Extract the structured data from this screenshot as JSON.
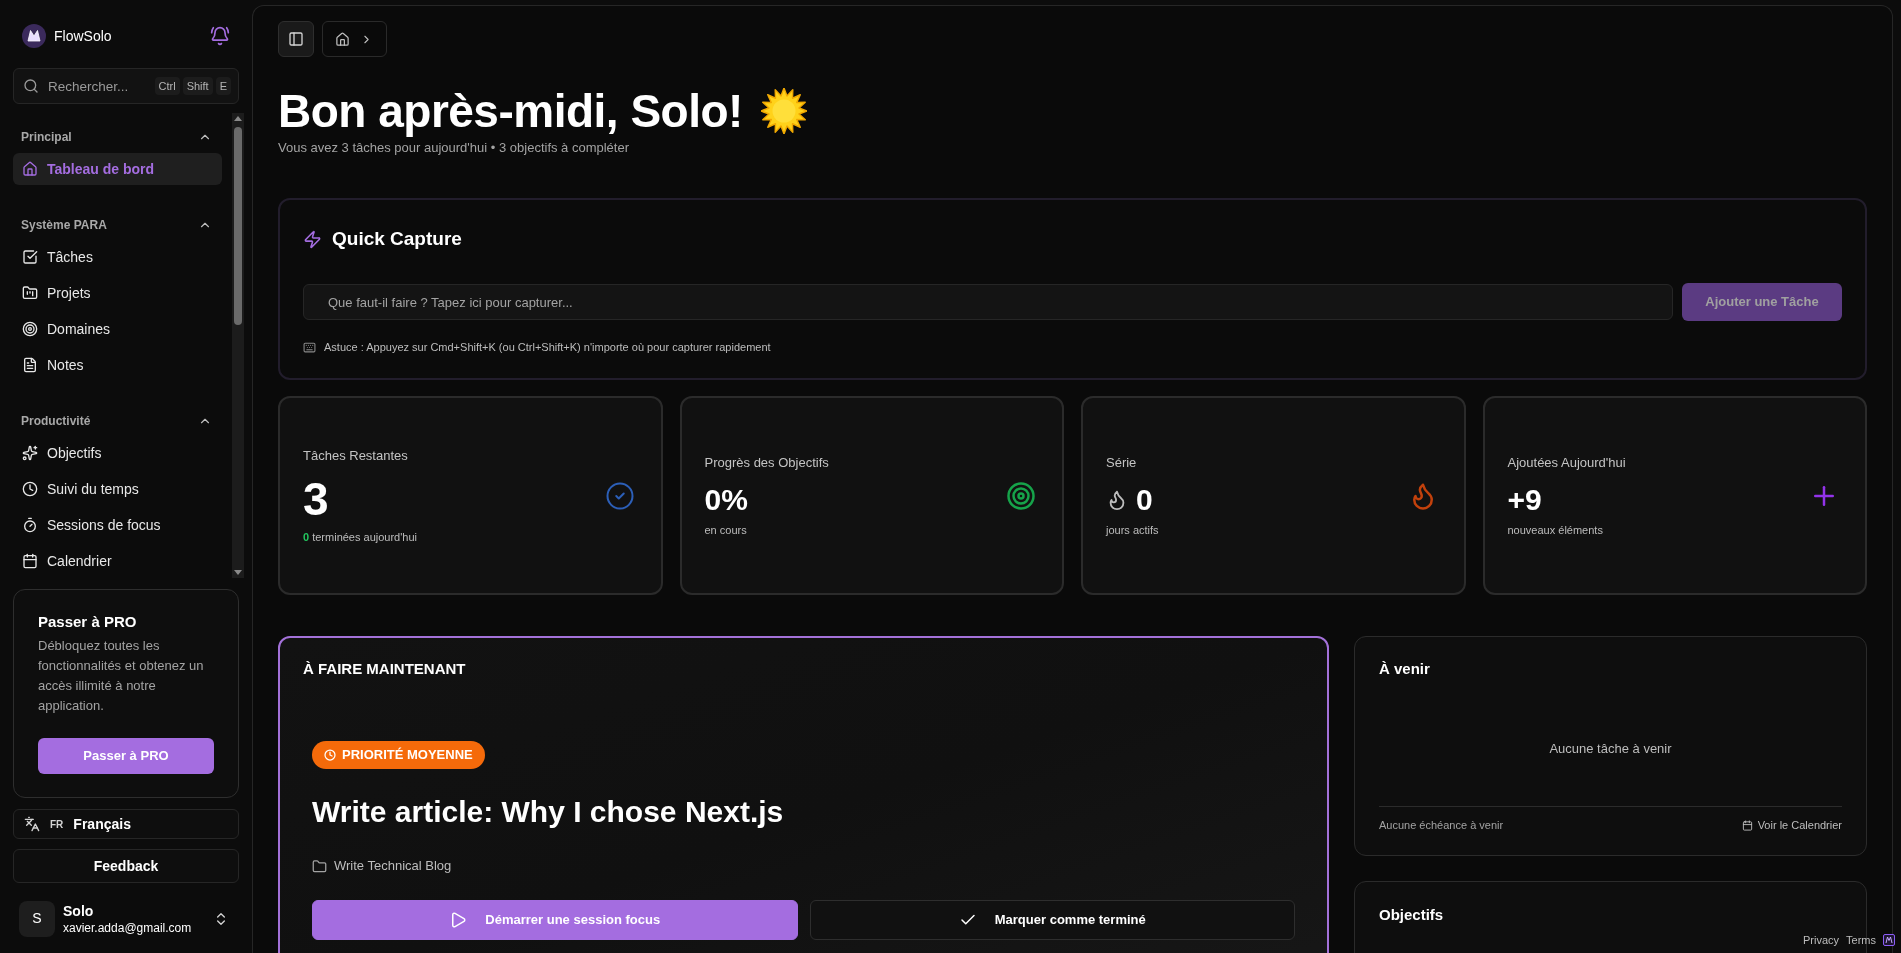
{
  "sidebar": {
    "brand": "FlowSolo",
    "search": {
      "placeholder": "Rechercher...",
      "shortcut": [
        "Ctrl",
        "Shift",
        "E"
      ]
    },
    "sections": [
      {
        "title": "Principal",
        "expanded": true,
        "items": [
          {
            "kind": "home",
            "label": "Tableau de bord",
            "selected": true
          }
        ]
      },
      {
        "title": "Système PARA",
        "expanded": true,
        "items": [
          {
            "kind": "tasks",
            "label": "Tâches",
            "selected": false
          },
          {
            "kind": "projects",
            "label": "Projets",
            "selected": false
          },
          {
            "kind": "areas",
            "label": "Domaines",
            "selected": false
          },
          {
            "kind": "notes",
            "label": "Notes",
            "selected": false
          }
        ]
      },
      {
        "title": "Productivité",
        "expanded": true,
        "items": [
          {
            "kind": "goals",
            "label": "Objectifs",
            "selected": false
          },
          {
            "kind": "time",
            "label": "Suivi du temps",
            "selected": false
          },
          {
            "kind": "focus",
            "label": "Sessions de focus",
            "selected": false
          },
          {
            "kind": "calendar",
            "label": "Calendrier",
            "selected": false
          }
        ]
      }
    ],
    "upgrade": {
      "title": "Passer à PRO",
      "text": "Débloquez toutes les fonctionnalités et obtenez un accès illimité à notre application.",
      "button": "Passer à PRO"
    },
    "language": {
      "code": "FR",
      "label": "Français"
    },
    "feedback": "Feedback",
    "user": {
      "initial": "S",
      "name": "Solo",
      "email": "xavier.adda@gmail.com"
    }
  },
  "header": {
    "greeting": "Bon après-midi, Solo!",
    "subtitle": "Vous avez 3 tâches pour aujourd'hui • 3 objectifs à compléter"
  },
  "quick_capture": {
    "title": "Quick Capture",
    "placeholder": "Que faut-il faire ? Tapez ici pour capturer...",
    "button": {
      "label": "Ajouter une Tâche",
      "disabled": true
    },
    "hint": "Astuce : Appuyez sur Cmd+Shift+K (ou Ctrl+Shift+K) n'importe où pour capturer rapidement"
  },
  "stats": [
    {
      "kind": "tasks",
      "label": "Tâches Restantes",
      "value": "3",
      "count": "0",
      "note": "terminées aujourd'hui"
    },
    {
      "kind": "goals",
      "label": "Progrès des Objectifs",
      "value": "0%",
      "note": "en cours"
    },
    {
      "kind": "streak",
      "label": "Série",
      "value": "0",
      "note": "jours actifs"
    },
    {
      "kind": "added",
      "label": "Ajoutées Aujourd'hui",
      "value": "+9",
      "note": "nouveaux éléments"
    }
  ],
  "do_now": {
    "heading": "À FAIRE MAINTENANT",
    "priority": "PRIORITÉ MOYENNE",
    "task": "Write article: Why I chose Next.js",
    "project": "Write Technical Blog",
    "actions": [
      {
        "kind": "focus",
        "label": "Démarrer une session focus"
      },
      {
        "kind": "complete",
        "label": "Marquer comme terminé"
      }
    ]
  },
  "upcoming": {
    "title": "À venir",
    "empty": "Aucune tâche à venir",
    "footer": "Aucune échéance à venir",
    "link": "Voir le Calendrier"
  },
  "goals": {
    "title": "Objectifs"
  },
  "footer_links": [
    "Privacy",
    "Terms"
  ]
}
